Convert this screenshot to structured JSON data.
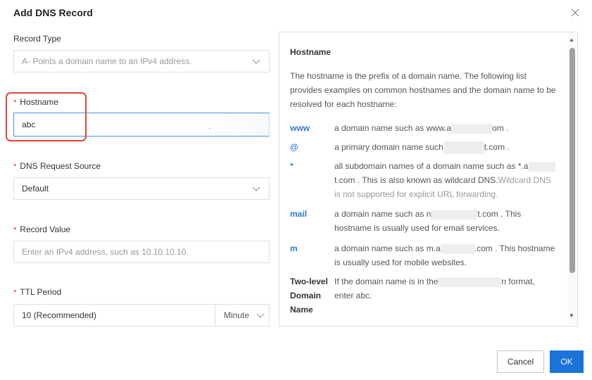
{
  "dialog": {
    "title": "Add DNS Record"
  },
  "form": {
    "record_type": {
      "label": "Record Type",
      "value": "A- Points a domain name to an IPv4 address."
    },
    "hostname": {
      "label": "Hostname",
      "value": "abc",
      "suffix": "."
    },
    "dns_request_source": {
      "label": "DNS Request Source",
      "value": "Default"
    },
    "record_value": {
      "label": "Record Value",
      "placeholder": "Enter an IPv4 address, such as 10.10.10.10."
    },
    "ttl": {
      "label": "TTL Period",
      "value": "10 (Recommended)",
      "unit": "Minute"
    },
    "required_mark": "*"
  },
  "help": {
    "title": "Hostname",
    "intro": "The hostname is the prefix of a domain name. The following list provides examples on common hostnames and the domain name to be resolved for each hostname:",
    "rows": [
      {
        "key": "www",
        "desc_a": "a domain name such as www.a",
        "desc_b": "om ."
      },
      {
        "key": "@",
        "desc_a": "a primary domain name such",
        "desc_b": "t.com ."
      },
      {
        "key": "*",
        "desc_a": "all subdomain names of a domain name such as *.a",
        "desc_b": "t.com . This is also known as wildcard DNS.",
        "note": "Wildcard DNS is not supported for explicit URL forwarding."
      },
      {
        "key": "mail",
        "desc_a": "a domain name such as n",
        "desc_b": "t.com . This hostname is usually used for email services."
      },
      {
        "key": "m",
        "desc_a": "a domain name such as m.a",
        "desc_b": ".com . This hostname is usually used for mobile websites."
      },
      {
        "key": "Two-level Domain Name",
        "desc_a": "If the domain name is in the",
        "desc_b": "n format, enter abc."
      }
    ]
  },
  "footer": {
    "cancel": "Cancel",
    "ok": "OK"
  }
}
